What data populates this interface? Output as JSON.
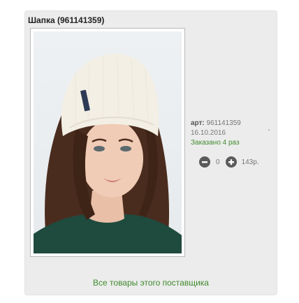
{
  "product": {
    "title": "Шапка (961141359)",
    "image_alt": "Шапка",
    "article_label": "арт:",
    "article_value": "961141359",
    "date": "16.10.2016",
    "ordered": "Заказано 4 раз",
    "tick_mark": "'",
    "quantity": "0",
    "price": "143р.",
    "minus_icon": "minus-circle-icon",
    "plus_icon": "plus-circle-icon"
  },
  "footer": {
    "supplier_link": "Все товары этого поставщика"
  },
  "colors": {
    "card_bg": "#ececec",
    "link_green": "#3f8a2e",
    "button_gray": "#5b5b5b",
    "hat": "#f3efe4",
    "sweater": "#1f4a3e",
    "hair": "#4a2c1e"
  }
}
